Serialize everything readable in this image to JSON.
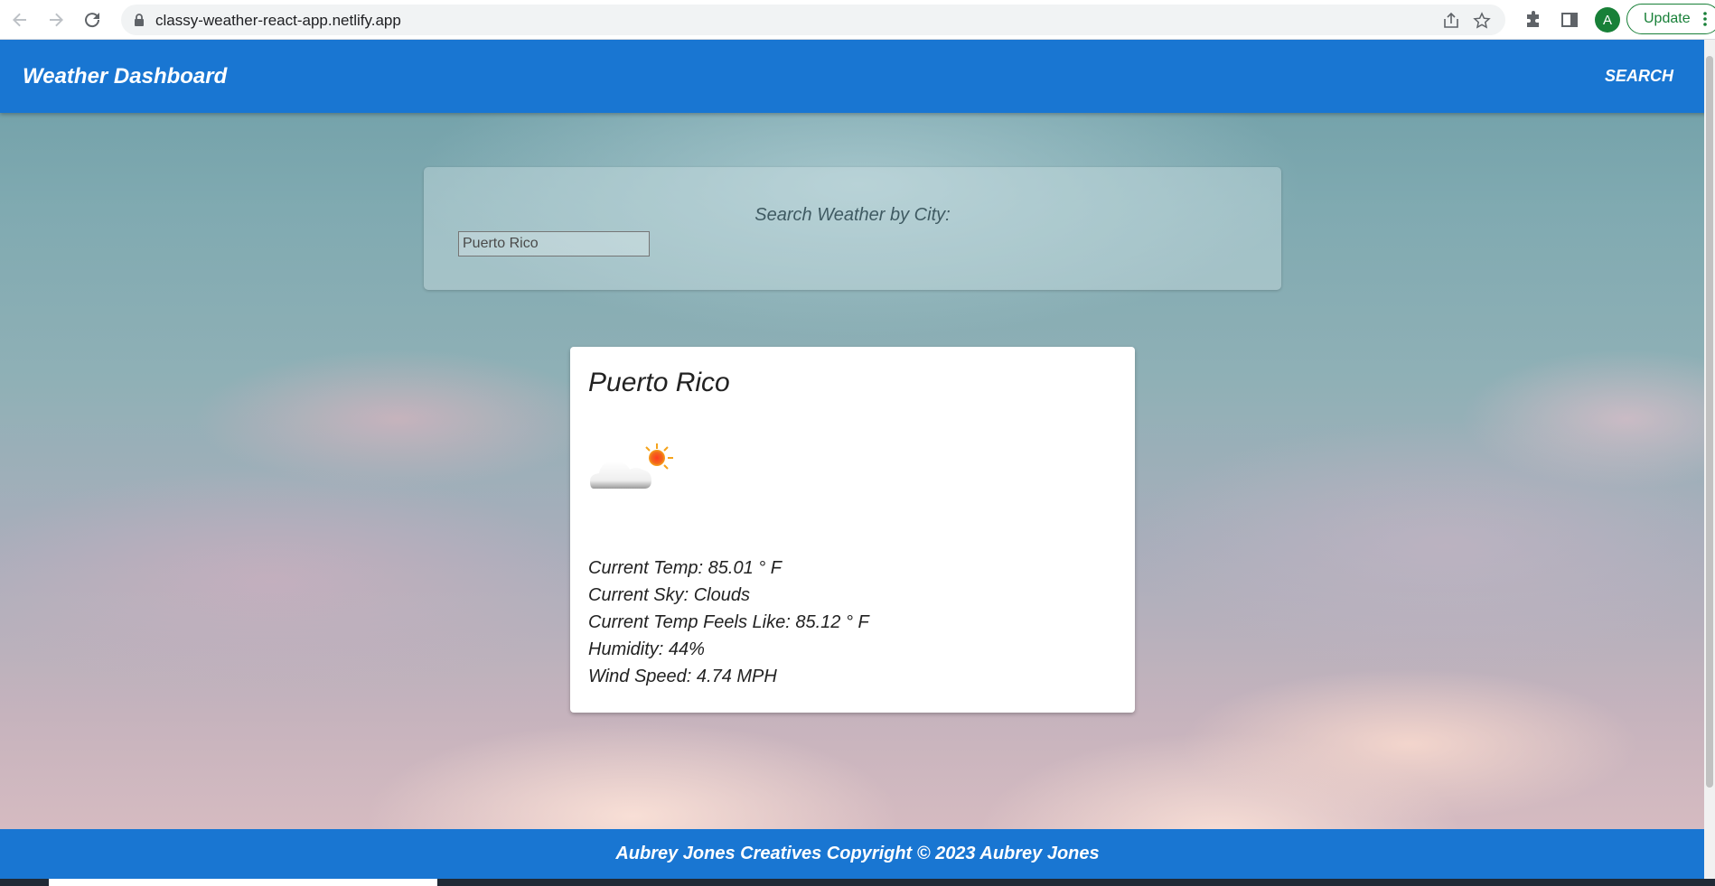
{
  "browser": {
    "url": "classy-weather-react-app.netlify.app",
    "profile_initial": "A",
    "update_label": "Update",
    "icons": {
      "back": "back-arrow-icon",
      "forward": "forward-arrow-icon",
      "reload": "reload-icon",
      "lock": "lock-icon",
      "share": "share-icon",
      "bookmark": "star-icon",
      "extensions": "puzzle-icon",
      "side_panel": "side-panel-icon",
      "menu": "vertical-dots-icon"
    }
  },
  "appbar": {
    "title": "Weather Dashboard",
    "search_label": "SEARCH",
    "color": "#1976d2"
  },
  "search": {
    "heading": "Search Weather by City:",
    "input_value": "Puerto Rico"
  },
  "weather": {
    "city": "Puerto Rico",
    "icon": "partly-cloudy-icon",
    "lines": [
      "Current Temp: 85.01 ° F",
      "Current Sky: Clouds",
      "Current Temp Feels Like: 85.12 ° F",
      "Humidity: 44%",
      "Wind Speed: 4.74 MPH"
    ]
  },
  "footer": {
    "text": "Aubrey Jones Creatives Copyright © 2023 Aubrey Jones"
  }
}
